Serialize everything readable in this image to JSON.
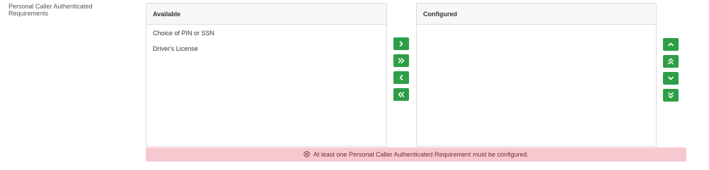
{
  "field": {
    "label": "Personal Caller Authenticated Requirements"
  },
  "available": {
    "title": "Available",
    "items": [
      "Choice of PIN or SSN",
      "Driver's License"
    ]
  },
  "configured": {
    "title": "Configured",
    "items": []
  },
  "transfer_buttons": [
    {
      "icon": "chevron-right-icon"
    },
    {
      "icon": "double-chevron-right-icon"
    },
    {
      "icon": "chevron-left-icon"
    },
    {
      "icon": "double-chevron-left-icon"
    }
  ],
  "order_buttons": [
    {
      "icon": "chevron-up-icon"
    },
    {
      "icon": "double-chevron-up-icon"
    },
    {
      "icon": "chevron-down-icon"
    },
    {
      "icon": "double-chevron-down-icon"
    }
  ],
  "alert": {
    "icon": "circle-x-icon",
    "message": "At least one Personal Caller Authenticated Requirement must be configured."
  },
  "colors": {
    "button": "#2e9e46",
    "alert_background": "#f8c8d0",
    "alert_text": "#6b2e36",
    "panel_border": "#dcdcdc"
  }
}
